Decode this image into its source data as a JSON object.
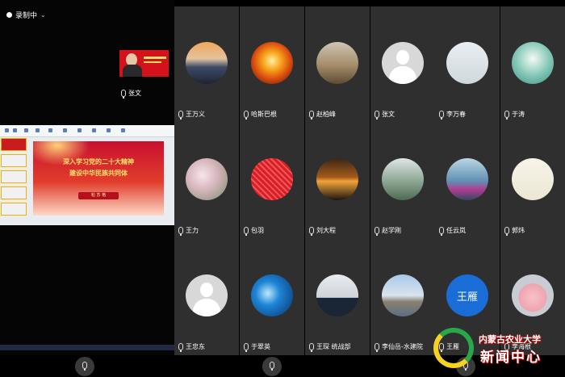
{
  "recording": {
    "label": "录制中"
  },
  "pip": {
    "name": "张文"
  },
  "slide": {
    "title_line1": "深入学习党的二十大精神",
    "title_line2": "建设中华民族共同体",
    "presenter": "帕 苏 格"
  },
  "participants": [
    {
      "name": "王万义",
      "avatar": "sunset-lake"
    },
    {
      "name": "哈斯巴根",
      "avatar": "orange-sun"
    },
    {
      "name": "赵柏峰",
      "avatar": "tree-road"
    },
    {
      "name": "张文",
      "avatar": "default-person"
    },
    {
      "name": "李万春",
      "avatar": "cartoon-man"
    },
    {
      "name": "于涛",
      "avatar": "teal-leaves"
    },
    {
      "name": "王力",
      "avatar": "blossom"
    },
    {
      "name": "包羽",
      "avatar": "red-pattern"
    },
    {
      "name": "刘大程",
      "avatar": "night-bridge"
    },
    {
      "name": "赵学刚",
      "avatar": "pavilion"
    },
    {
      "name": "任云岚",
      "avatar": "lake-woman"
    },
    {
      "name": "郭炜",
      "avatar": "calligraphy"
    },
    {
      "name": "王忠东",
      "avatar": "default-person"
    },
    {
      "name": "于翠英",
      "avatar": "blue-abstract"
    },
    {
      "name": "王琛 统战部",
      "avatar": "man-portrait"
    },
    {
      "name": "李仙岳-水建院",
      "avatar": "harbor"
    },
    {
      "name": "王雁",
      "avatar": "initial",
      "initial": "王雁"
    },
    {
      "name": "李海根",
      "avatar": "pig-cartoon"
    }
  ],
  "watermark": {
    "line1": "内蒙古农业大学",
    "line2": "新闻中心"
  },
  "colors": {
    "tile_bg": "#2f2f2f",
    "accent_blue": "#1a6cd6",
    "slide_red": "#c8102e"
  }
}
